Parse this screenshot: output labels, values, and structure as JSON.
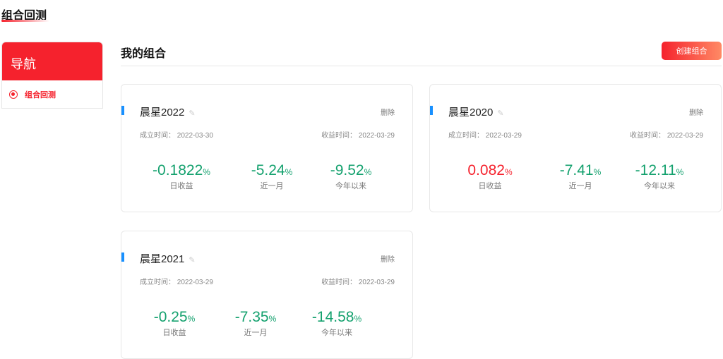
{
  "page_title": "组合回测",
  "sidebar": {
    "header": "导航",
    "items": [
      {
        "label": "组合回测"
      }
    ]
  },
  "main": {
    "title": "我的组合",
    "create_label": "创建组合",
    "cards": [
      {
        "name": "晨星2022",
        "delete": "删除",
        "created_label": "成立时间：",
        "created": "2022-03-30",
        "return_label": "收益时间：",
        "return_date": "2022-03-29",
        "stats": [
          {
            "value": "-0.1822",
            "unit": "%",
            "label": "日收益",
            "tone": "green"
          },
          {
            "value": "-5.24",
            "unit": "%",
            "label": "近一月",
            "tone": "green"
          },
          {
            "value": "-9.52",
            "unit": "%",
            "label": "今年以来",
            "tone": "green"
          }
        ]
      },
      {
        "name": "晨星2020",
        "delete": "删除",
        "created_label": "成立时间：",
        "created": "2022-03-29",
        "return_label": "收益时间：",
        "return_date": "2022-03-29",
        "stats": [
          {
            "value": "0.082",
            "unit": "%",
            "label": "日收益",
            "tone": "red"
          },
          {
            "value": "-7.41",
            "unit": "%",
            "label": "近一月",
            "tone": "green"
          },
          {
            "value": "-12.11",
            "unit": "%",
            "label": "今年以来",
            "tone": "green"
          }
        ]
      },
      {
        "name": "晨星2021",
        "delete": "删除",
        "created_label": "成立时间：",
        "created": "2022-03-29",
        "return_label": "收益时间：",
        "return_date": "2022-03-29",
        "stats": [
          {
            "value": "-0.25",
            "unit": "%",
            "label": "日收益",
            "tone": "green"
          },
          {
            "value": "-7.35",
            "unit": "%",
            "label": "近一月",
            "tone": "green"
          },
          {
            "value": "-14.58",
            "unit": "%",
            "label": "今年以来",
            "tone": "green"
          }
        ]
      }
    ]
  },
  "colors": {
    "accent": "#f5222d",
    "positive": "#f5222d",
    "negative": "#14a16e",
    "marker": "#1890ff"
  }
}
